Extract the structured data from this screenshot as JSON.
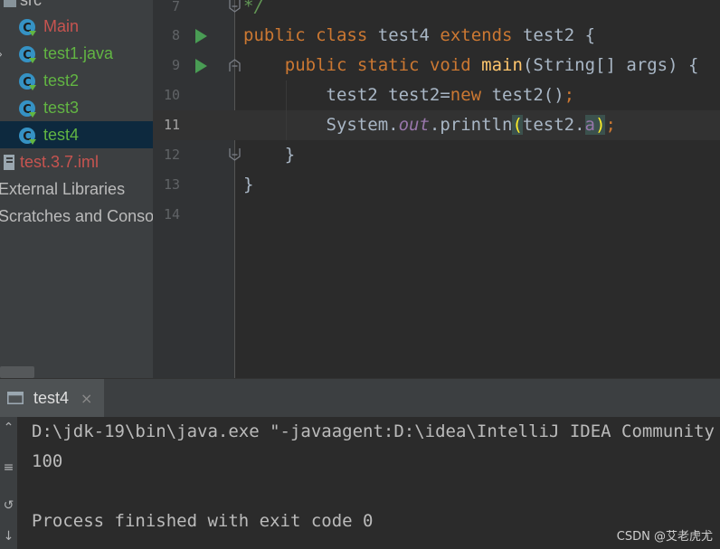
{
  "sidebar": {
    "items": [
      {
        "label": "src",
        "color": "#bbbbbb",
        "kind": "folder"
      },
      {
        "label": "Main",
        "color": "#c75450",
        "kind": "class"
      },
      {
        "label": "test1.java",
        "color": "#62b543",
        "kind": "class"
      },
      {
        "label": "test2",
        "color": "#62b543",
        "kind": "class"
      },
      {
        "label": "test3",
        "color": "#62b543",
        "kind": "class"
      },
      {
        "label": "test4",
        "color": "#62b543",
        "kind": "class",
        "selected": true
      },
      {
        "label": "test.3.7.iml",
        "color": "#c75450",
        "kind": "file"
      },
      {
        "label": "External Libraries",
        "color": "#bbbbbb",
        "kind": "library"
      },
      {
        "label": "Scratches and Consoles",
        "color": "#bbbbbb",
        "kind": "scratch"
      }
    ]
  },
  "editor": {
    "line_numbers": [
      "7",
      "8",
      "9",
      "10",
      "11",
      "12",
      "13",
      "14"
    ],
    "current_line": "11",
    "code": {
      "l7_comment": "*/",
      "l8_public": "public",
      "l8_class": "class",
      "l8_name": "test4",
      "l8_extends": "extends",
      "l8_super": "test2 {",
      "l9_public": "public",
      "l9_static": "static",
      "l9_void": "void",
      "l9_main": "main",
      "l9_params": "(String[] args) {",
      "l10_decl": "test2 test2=",
      "l10_new": "new",
      "l10_ctor": " test2()",
      "l10_semi": ";",
      "l11_system": "System.",
      "l11_out": "out",
      "l11_println": ".println",
      "l11_lparen": "(",
      "l11_arg": "test2.",
      "l11_field": "a",
      "l11_rparen": ")",
      "l11_semi": ";",
      "l12_brace": "}",
      "l13_brace": "}"
    }
  },
  "run": {
    "tab_label": "test4",
    "tab_close": "×",
    "console": [
      "D:\\jdk-19\\bin\\java.exe \"-javaagent:D:\\idea\\IntelliJ IDEA Community",
      "100",
      "",
      "Process finished with exit code 0"
    ]
  },
  "watermark": "CSDN @艾老虎尤",
  "colors": {
    "keyword": "#cc7832",
    "method": "#ffc66d",
    "field": "#9876aa",
    "comment": "#629755",
    "run_green": "#499c54",
    "selection": "#0d293e"
  }
}
